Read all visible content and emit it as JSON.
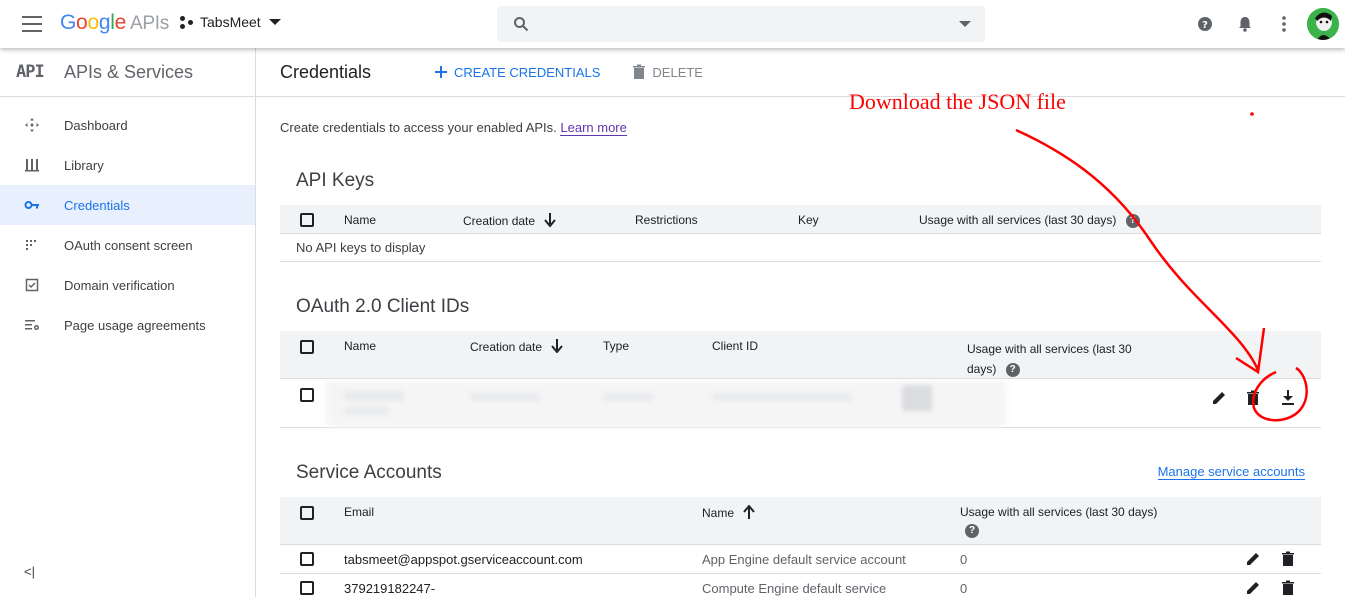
{
  "topbar": {
    "logo_parts": [
      "G",
      "o",
      "o",
      "g",
      "l",
      "e"
    ],
    "logo_suffix": "APIs",
    "project_name": "TabsMeet",
    "search_placeholder": ""
  },
  "sidebar": {
    "badge": "API",
    "title": "APIs & Services",
    "items": [
      {
        "label": "Dashboard",
        "icon": "dashboard-icon"
      },
      {
        "label": "Library",
        "icon": "library-icon"
      },
      {
        "label": "Credentials",
        "icon": "key-icon",
        "active": true
      },
      {
        "label": "OAuth consent screen",
        "icon": "consent-icon"
      },
      {
        "label": "Domain verification",
        "icon": "checkbox-icon"
      },
      {
        "label": "Page usage agreements",
        "icon": "settings-list-icon"
      }
    ],
    "collapse_label": "<|"
  },
  "main": {
    "title": "Credentials",
    "create_label": "CREATE CREDENTIALS",
    "delete_label": "DELETE",
    "intro_text": "Create credentials to access your enabled APIs.",
    "learn_more": "Learn more"
  },
  "api_keys": {
    "title": "API Keys",
    "headers": [
      "Name",
      "Creation date",
      "Restrictions",
      "Key",
      "Usage with all services (last 30 days)"
    ],
    "empty_text": "No API keys to display"
  },
  "oauth": {
    "title": "OAuth 2.0 Client IDs",
    "headers": [
      "Name",
      "Creation date",
      "Type",
      "Client ID",
      "Usage with all services (last 30",
      "days)"
    ]
  },
  "service_accounts": {
    "title": "Service Accounts",
    "manage_label": "Manage service accounts",
    "headers": [
      "Email",
      "Name",
      "Usage with all services (last 30 days)"
    ],
    "rows": [
      {
        "email": "tabsmeet@appspot.gserviceaccount.com",
        "name": "App Engine default service account",
        "usage": "0"
      },
      {
        "email": "379219182247-",
        "name": "Compute Engine default service",
        "usage": "0"
      }
    ]
  },
  "annotation": {
    "text": "Download the JSON file",
    "color": "#ff0000"
  },
  "colors": {
    "accent": "#1a73e8",
    "active_bg": "#e8f0fe",
    "header_bg": "#f1f3f4"
  }
}
